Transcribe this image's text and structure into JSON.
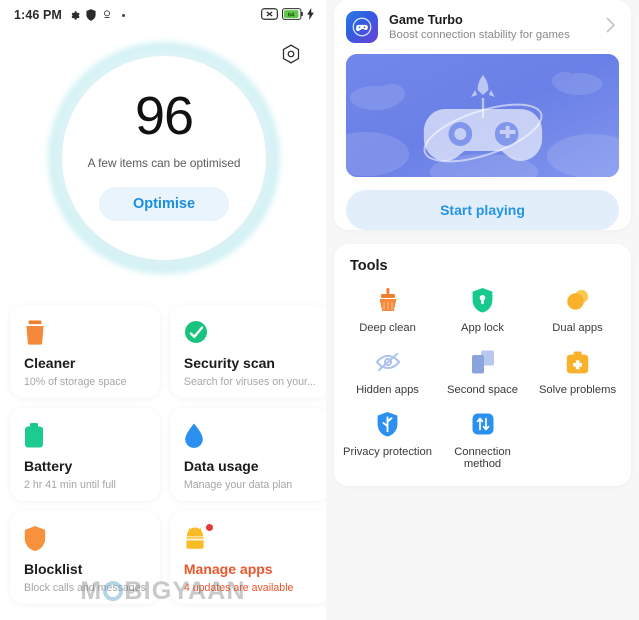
{
  "statusbar": {
    "time": "1:46 PM",
    "icons": [
      "gear-icon",
      "shield-icon",
      "location-pin-icon",
      "dot-icon"
    ],
    "right_icons": [
      "silent-mode-icon",
      "battery-icon",
      "charging-bolt-icon"
    ],
    "battery_level": "64"
  },
  "security_score": {
    "settings_icon": "hexagon-settings-icon",
    "score": "96",
    "subtitle": "A few items can be optimised",
    "button_label": "Optimise",
    "accent_color": "#1a8ee0",
    "glow_color": "#a0e2e9"
  },
  "cards": [
    {
      "icon": "trash-bin-icon",
      "icon_color": "#f0802e",
      "title": "Cleaner",
      "subtitle": "10% of storage space",
      "alert": false
    },
    {
      "icon": "security-check-circle-icon",
      "icon_color": "#19c37d",
      "title": "Security scan",
      "subtitle": "Search for viruses on your...",
      "alert": false
    },
    {
      "icon": "battery-icon",
      "icon_color": "#19c98a",
      "title": "Battery",
      "subtitle": "2 hr 41 min  until full",
      "alert": false
    },
    {
      "icon": "water-drop-icon",
      "icon_color": "#2b90f0",
      "title": "Data usage",
      "subtitle": "Manage your data plan",
      "alert": false
    },
    {
      "icon": "shield-icon",
      "icon_color": "#f7913d",
      "title": "Blocklist",
      "subtitle": "Block calls and messages",
      "alert": false
    },
    {
      "icon": "android-apps-icon",
      "icon_color": "#f9bc26",
      "title": "Manage apps",
      "subtitle": "4 updates are available",
      "alert": true,
      "badge": true
    }
  ],
  "watermark": {
    "text_before": "M",
    "text_after": "BIGYAAN"
  },
  "game_turbo": {
    "app_icon": "gamepad-icon",
    "title": "Game Turbo",
    "subtitle": "Boost connection stability for games",
    "chevron": "chevron-right-icon",
    "banner_alt": "gamepad-rocket-clouds-illustration",
    "button_label": "Start playing",
    "button_color": "#2494e4"
  },
  "tools": {
    "title": "Tools",
    "items": [
      {
        "icon": "broom-icon",
        "icon_color": "#f0802e",
        "label": "Deep clean"
      },
      {
        "icon": "lock-shield-icon",
        "icon_color": "#16c98c",
        "label": "App lock"
      },
      {
        "icon": "dual-circles-icon",
        "icon_color": "#f9b12a",
        "label": "Dual apps"
      },
      {
        "icon": "eye-slash-icon",
        "icon_color": "#aec4ee",
        "label": "Hidden apps"
      },
      {
        "icon": "two-windows-icon",
        "icon_color": "#8ba4e0",
        "label": "Second space"
      },
      {
        "icon": "first-aid-kit-icon",
        "icon_color": "#f9b12a",
        "label": "Solve problems"
      },
      {
        "icon": "privacy-shield-icon",
        "icon_color": "#2b90f0",
        "label": "Privacy protection"
      },
      {
        "icon": "transfer-arrows-icon",
        "icon_color": "#2b90f0",
        "label": "Connection method"
      }
    ]
  }
}
